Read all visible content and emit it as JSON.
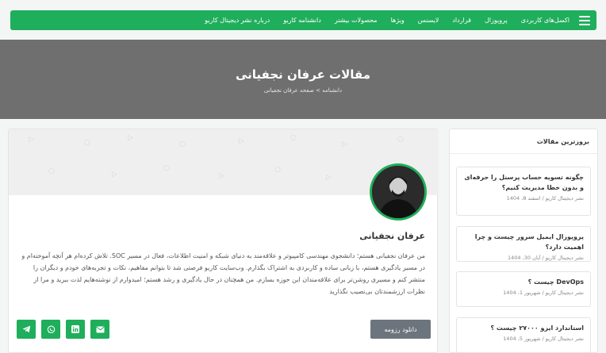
{
  "nav": {
    "items": [
      "اکسل‌های کاربردی",
      "پروپوزال",
      "قرارداد",
      "لایسنس",
      "ویژها",
      "محصولات بیشتر",
      "دانشنامه کاریو",
      "درباره نشر دیجیتال کاریو"
    ]
  },
  "hero": {
    "title": "مقالات عرفان نجفیانی",
    "breadcrumb": "دانشنامه > صفحه عرفان نجفیانی"
  },
  "author": {
    "name": "عرفان نجفیانی",
    "bio": "من عرفان نجفیانی هستم؛ دانشجوی مهندسی کامپیوتر و علاقه‌مند به دنیای شبکه و امنیت اطلاعات، فعال در مسیر SOC. تلاش کرده‌ام هر آنچه آموخته‌ام و در مسیر یادگیری هستم، با زبانی ساده و کاربردی به اشتراک بگذارم. وب‌سایت کاریو فرصتی شد تا بتوانم مفاهیم، نکات و تجربه‌های خودم و دیگران را منتشر کنم و مسیری روشن‌تر برای علاقه‌مندان این حوزه بسازم. من همچنان در حال یادگیری و رشد هستم؛ امیدوارم از نوشته‌هایم لذت ببرید و مرا از نظرات ارزشمندتان بی‌نصیب نگذارید",
    "resume_label": "دانلود رزومه"
  },
  "socials": [
    {
      "icon": "telegram-icon"
    },
    {
      "icon": "whatsapp-icon"
    },
    {
      "icon": "linkedin-icon"
    },
    {
      "icon": "email-icon"
    }
  ],
  "sidebar": {
    "title": "بروزترین مقالات",
    "posts": [
      {
        "title": "چگونه تسویه حساب پرسنل را حرفه‌ای و بدون خطا مدیریت کنیم؟",
        "meta": "نشر دیجیتال کاریو / اسفند 8، 1404"
      },
      {
        "title": "پروپوزال ایمیل سرور چیست و چرا اهمیت دارد؟",
        "meta": "نشر دیجیتال کاریو / آبان 30، 1404"
      },
      {
        "title": "DevOps چیست ؟",
        "meta": "نشر دیجیتال کاریو / شهریور 1، 1404"
      },
      {
        "title": "استاندارد ایزو ۲۷۰۰۰ چیست ؟",
        "meta": "نشر دیجیتال کاریو / شهریور 5، 1404"
      }
    ]
  },
  "colors": {
    "accent": "#1fae5b",
    "hero": "#6f6f6f",
    "button": "#6c757d"
  }
}
